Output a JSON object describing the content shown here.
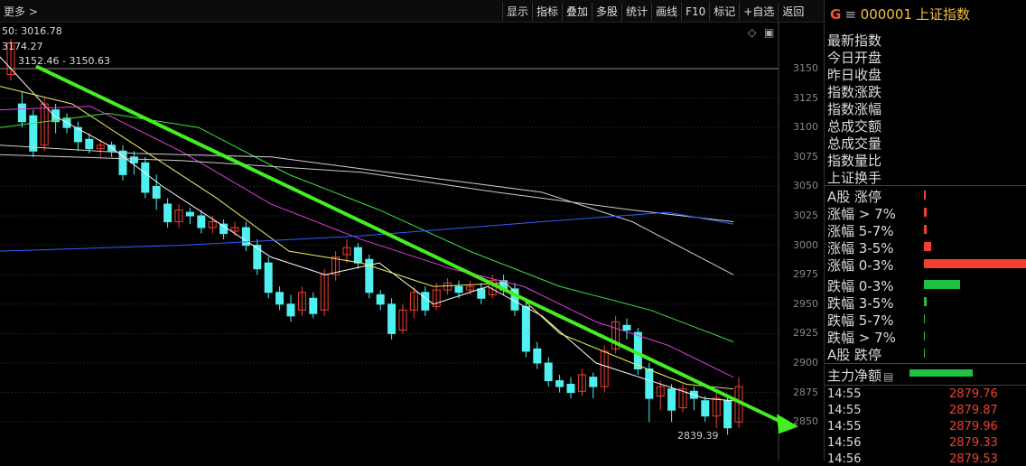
{
  "topbar": {
    "more_label": "更多 >",
    "tools": [
      "显示",
      "指标",
      "叠加",
      "多股",
      "统计",
      "画线",
      "F10",
      "标记",
      "+自选",
      "返回"
    ]
  },
  "chart": {
    "ma_label": "50: 3016.78",
    "high_label": "3174.27",
    "range_label": "3152.46 - 3150.63",
    "low_label": "2839.39",
    "y_ticks": [
      "3150",
      "3125",
      "3100",
      "3075",
      "3050",
      "3025",
      "3000",
      "2975",
      "2950",
      "2925",
      "2900",
      "2875",
      "2850"
    ],
    "colors": {
      "up": "#f04030",
      "down": "#50f0f0",
      "trend": "#44ee22",
      "ma5": "#ffffff",
      "ma10": "#f0f060",
      "ma20": "#e040e0",
      "ma30": "#40e040",
      "ma60": "#d0d0d0",
      "ma120": "#3060ff"
    }
  },
  "quote": {
    "exchange_icon": "G",
    "menu_icon": "≡",
    "code": "000001",
    "name": "上证指数",
    "fields": [
      "最新指数",
      "今日开盘",
      "昨日收盘",
      "指数涨跌",
      "指数涨幅",
      "总成交额",
      "总成交量",
      "指数量比",
      "上证换手"
    ],
    "breadth": [
      {
        "label": "A股 涨停",
        "color": "#f04030"
      },
      {
        "label": "涨幅 > 7%",
        "color": "#f04030"
      },
      {
        "label": "涨幅 5-7%",
        "color": "#f04030"
      },
      {
        "label": "涨幅 3-5%",
        "color": "#f04030"
      },
      {
        "label": "涨幅 0-3%",
        "color": "#f04030"
      },
      {
        "label": "跌幅 0-3%",
        "color": "#20c040"
      },
      {
        "label": "跌幅 3-5%",
        "color": "#20c040"
      },
      {
        "label": "跌幅 5-7%",
        "color": "#20c040"
      },
      {
        "label": "跌幅 > 7%",
        "color": "#20c040"
      },
      {
        "label": "A股 跌停",
        "color": "#20c040"
      }
    ],
    "net_flow_label": "主力净额",
    "net_flow_icon": "list-icon",
    "ticks": [
      {
        "time": "14:55",
        "value": "2879.76"
      },
      {
        "time": "14:55",
        "value": "2879.87"
      },
      {
        "time": "14:55",
        "value": "2879.96"
      },
      {
        "time": "14:56",
        "value": "2879.33"
      },
      {
        "time": "14:56",
        "value": "2879.53"
      }
    ]
  }
}
